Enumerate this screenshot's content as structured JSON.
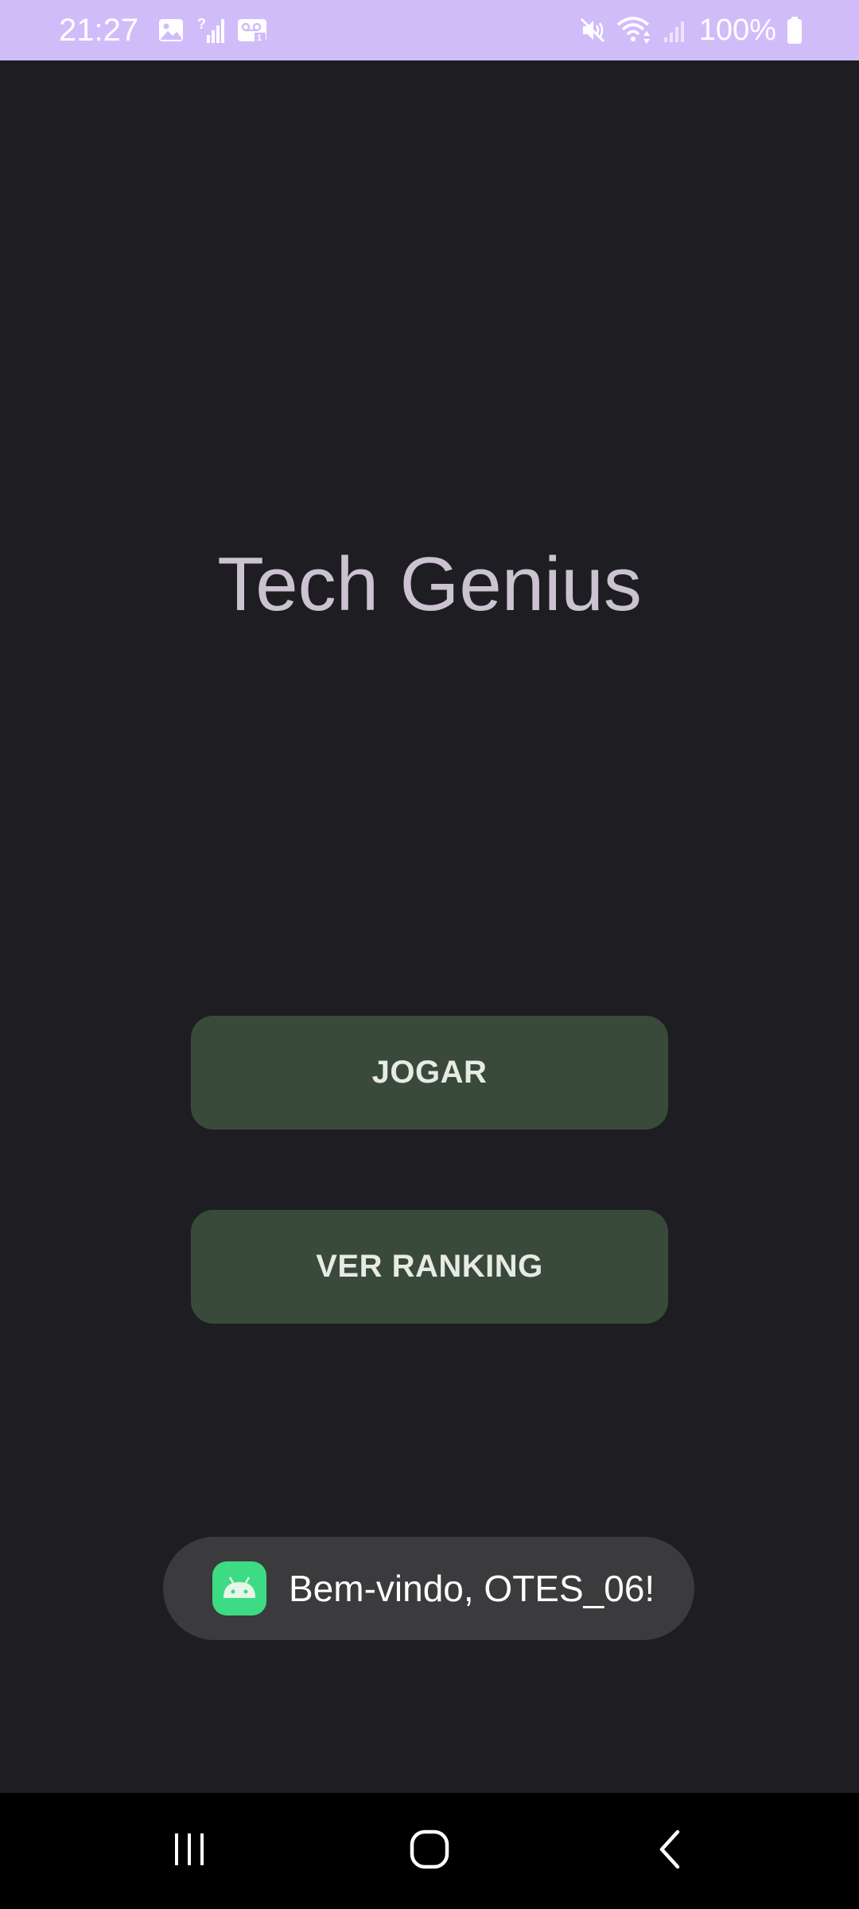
{
  "status_bar": {
    "time": "21:27",
    "battery_text": "100%",
    "left_icons": [
      "gallery-icon",
      "no-signal-icon",
      "voicemail-icon"
    ],
    "right_icons": [
      "mute-icon",
      "wifi-icon",
      "signal-icon",
      "battery-icon"
    ],
    "background_color": "#d1bcfa"
  },
  "main": {
    "title": "Tech Genius",
    "play_button_label": "JOGAR",
    "ranking_button_label": "VER RANKING",
    "button_color": "#3a4a3a"
  },
  "toast": {
    "message": "Bem-vindo, OTES_06!",
    "icon": "android-app-icon"
  },
  "nav_bar": {
    "buttons": [
      "recents-icon",
      "home-icon",
      "back-icon"
    ]
  }
}
